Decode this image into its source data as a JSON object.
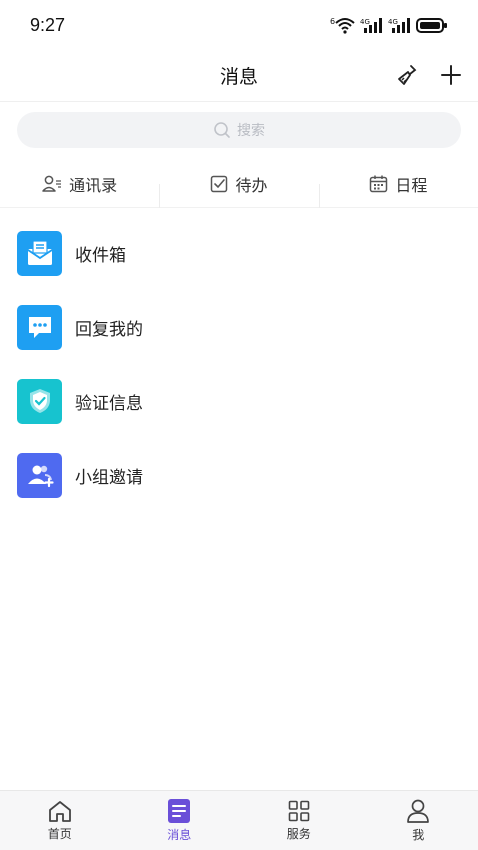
{
  "status_bar": {
    "time": "9:27",
    "net1": "4G",
    "net2": "4G",
    "wifi_badge": "6"
  },
  "header": {
    "title": "消息"
  },
  "search": {
    "placeholder": "搜索"
  },
  "quick_tabs": [
    {
      "label": "通讯录",
      "icon": "contacts-icon"
    },
    {
      "label": "待办",
      "icon": "todo-check-icon"
    },
    {
      "label": "日程",
      "icon": "calendar-icon"
    }
  ],
  "items": [
    {
      "label": "收件箱",
      "icon": "inbox-icon",
      "color": "#1e9ff2"
    },
    {
      "label": "回复我的",
      "icon": "reply-chat-icon",
      "color": "#1e9ff2"
    },
    {
      "label": "验证信息",
      "icon": "shield-check-icon",
      "color": "#17c3cf"
    },
    {
      "label": "小组邀请",
      "icon": "group-invite-icon",
      "color": "#4f6af0"
    }
  ],
  "tabbar": [
    {
      "label": "首页",
      "icon": "home-icon",
      "active": false
    },
    {
      "label": "消息",
      "icon": "message-doc-icon",
      "active": true
    },
    {
      "label": "服务",
      "icon": "grid-apps-icon",
      "active": false
    },
    {
      "label": "我",
      "icon": "person-icon",
      "active": false
    }
  ],
  "colors": {
    "accent": "#6a4fd8",
    "search_bg": "#f2f3f5",
    "tabbar_bg": "#f7f7f8"
  }
}
